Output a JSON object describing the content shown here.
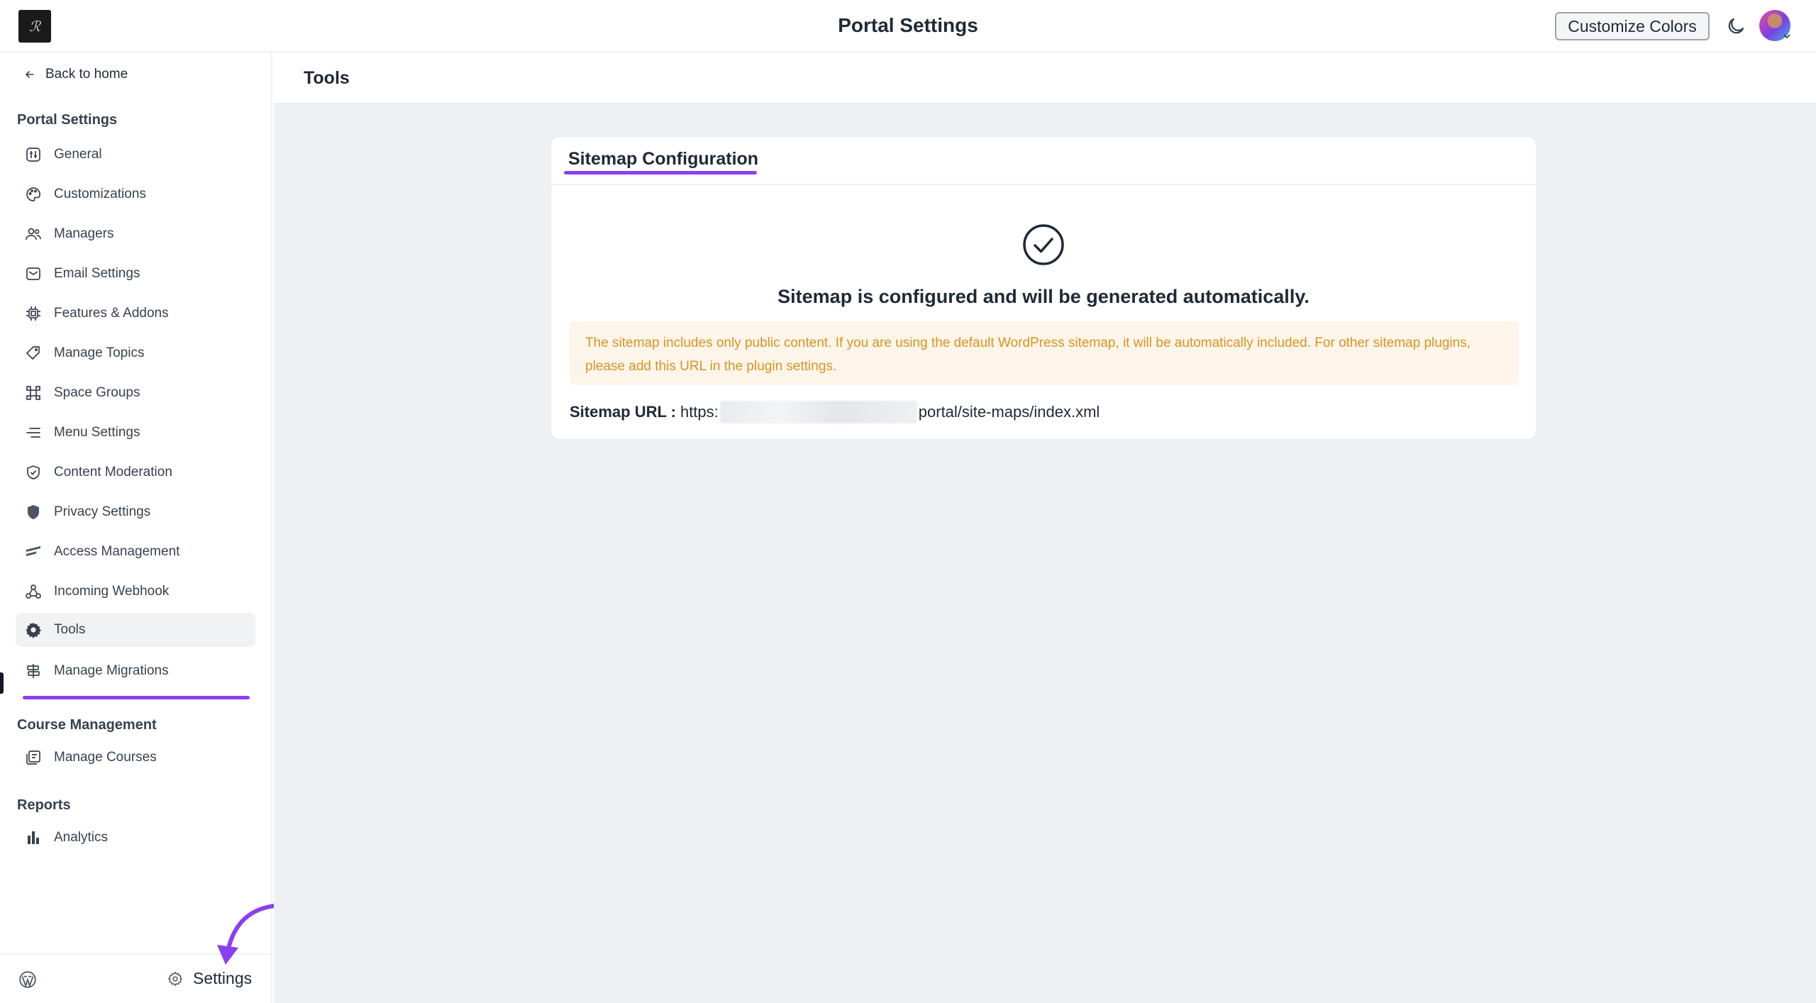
{
  "header": {
    "title": "Portal Settings",
    "customize_label": "Customize Colors"
  },
  "sidebar": {
    "back_label": "Back to home",
    "portal_section": "Portal Settings",
    "items": [
      {
        "label": "General",
        "icon": "general-icon"
      },
      {
        "label": "Customizations",
        "icon": "palette-icon"
      },
      {
        "label": "Managers",
        "icon": "users-icon"
      },
      {
        "label": "Email Settings",
        "icon": "mail-icon"
      },
      {
        "label": "Features & Addons",
        "icon": "chip-icon"
      },
      {
        "label": "Manage Topics",
        "icon": "tag-icon"
      },
      {
        "label": "Space Groups",
        "icon": "group-icon"
      },
      {
        "label": "Menu Settings",
        "icon": "menu-icon"
      },
      {
        "label": "Content Moderation",
        "icon": "shield-check-icon"
      },
      {
        "label": "Privacy Settings",
        "icon": "shield-icon"
      },
      {
        "label": "Access Management",
        "icon": "access-icon"
      },
      {
        "label": "Incoming Webhook",
        "icon": "webhook-icon"
      },
      {
        "label": "Tools",
        "icon": "gear-icon",
        "active": true
      },
      {
        "label": "Manage Migrations",
        "icon": "migration-icon"
      }
    ],
    "course_section": "Course Management",
    "course_items": [
      {
        "label": "Manage Courses",
        "icon": "courses-icon"
      }
    ],
    "reports_section": "Reports",
    "report_items": [
      {
        "label": "Analytics",
        "icon": "bar-chart-icon"
      }
    ],
    "footer_settings_label": "Settings"
  },
  "main": {
    "page_title": "Tools",
    "card": {
      "tab_label": "Sitemap Configuration",
      "status_message": "Sitemap is configured and will be generated automatically.",
      "notice": "The sitemap includes only public content. If you are using the default WordPress sitemap, it will be automatically included. For other sitemap plugins, please add this URL in the plugin settings.",
      "url_label": "Sitemap URL :",
      "url_prefix": "https:",
      "url_suffix": "portal/site-maps/index.xml"
    }
  },
  "colors": {
    "accent": "#8b3ff2",
    "notice_bg": "#fdf5ea",
    "notice_text": "#d99422",
    "main_bg": "#eef1f4"
  }
}
